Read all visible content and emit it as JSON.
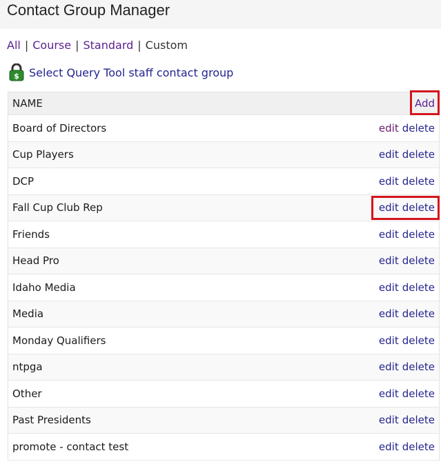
{
  "page": {
    "title": "Contact Group Manager"
  },
  "filters": {
    "items": [
      {
        "label": "All",
        "link": true
      },
      {
        "label": "Course",
        "link": true
      },
      {
        "label": "Standard",
        "link": true
      },
      {
        "label": "Custom",
        "link": false
      }
    ]
  },
  "query_tool": {
    "label": "Select Query Tool staff contact group",
    "icon": "lock-icon"
  },
  "table": {
    "header_name": "NAME",
    "add_label": "Add",
    "edit_label": "edit",
    "delete_label": "delete",
    "rows": [
      "Board of Directors",
      "Cup Players",
      "DCP",
      "Fall Cup Club Rep",
      "Friends",
      "Head Pro",
      "Idaho Media",
      "Media",
      "Monday Qualifiers",
      "ntpga",
      "Other",
      "Past Presidents",
      "promote - contact test"
    ]
  },
  "colors": {
    "link": "#24248f",
    "visited": "#5b1f8f",
    "highlight": "#d4141c"
  }
}
